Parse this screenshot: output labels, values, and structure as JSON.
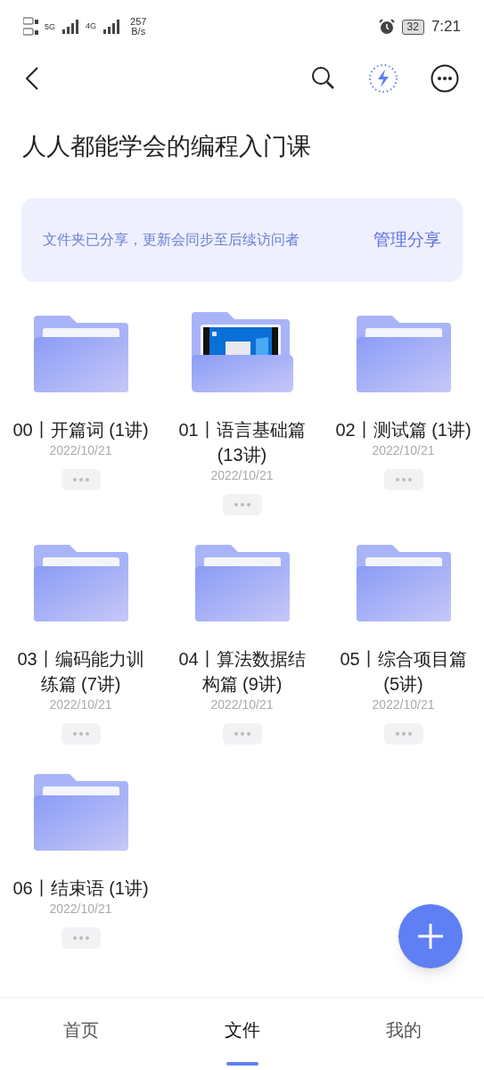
{
  "status_bar": {
    "network_5g": "5G",
    "network_4g": "4G",
    "speed_value": "257",
    "speed_unit": "B/s",
    "battery": "32",
    "time": "7:21"
  },
  "title": "人人都能学会的编程入门课",
  "share_banner": {
    "message": "文件夹已分享，更新会同步至后续访问者",
    "action": "管理分享"
  },
  "folders": [
    {
      "name": "00丨开篇词 (1讲)",
      "date": "2022/10/21",
      "kind": "plain"
    },
    {
      "name": "01丨语言基础篇 (13讲)",
      "date": "2022/10/21",
      "kind": "preview"
    },
    {
      "name": "02丨测试篇 (1讲)",
      "date": "2022/10/21",
      "kind": "plain"
    },
    {
      "name": "03丨编码能力训练篇 (7讲)",
      "date": "2022/10/21",
      "kind": "plain"
    },
    {
      "name": "04丨算法数据结构篇 (9讲)",
      "date": "2022/10/21",
      "kind": "plain"
    },
    {
      "name": "05丨综合项目篇 (5讲)",
      "date": "2022/10/21",
      "kind": "plain"
    },
    {
      "name": "06丨结束语 (1讲)",
      "date": "2022/10/21",
      "kind": "plain"
    }
  ],
  "tabs": [
    {
      "label": "首页",
      "selected": false
    },
    {
      "label": "文件",
      "selected": true
    },
    {
      "label": "我的",
      "selected": false
    }
  ]
}
